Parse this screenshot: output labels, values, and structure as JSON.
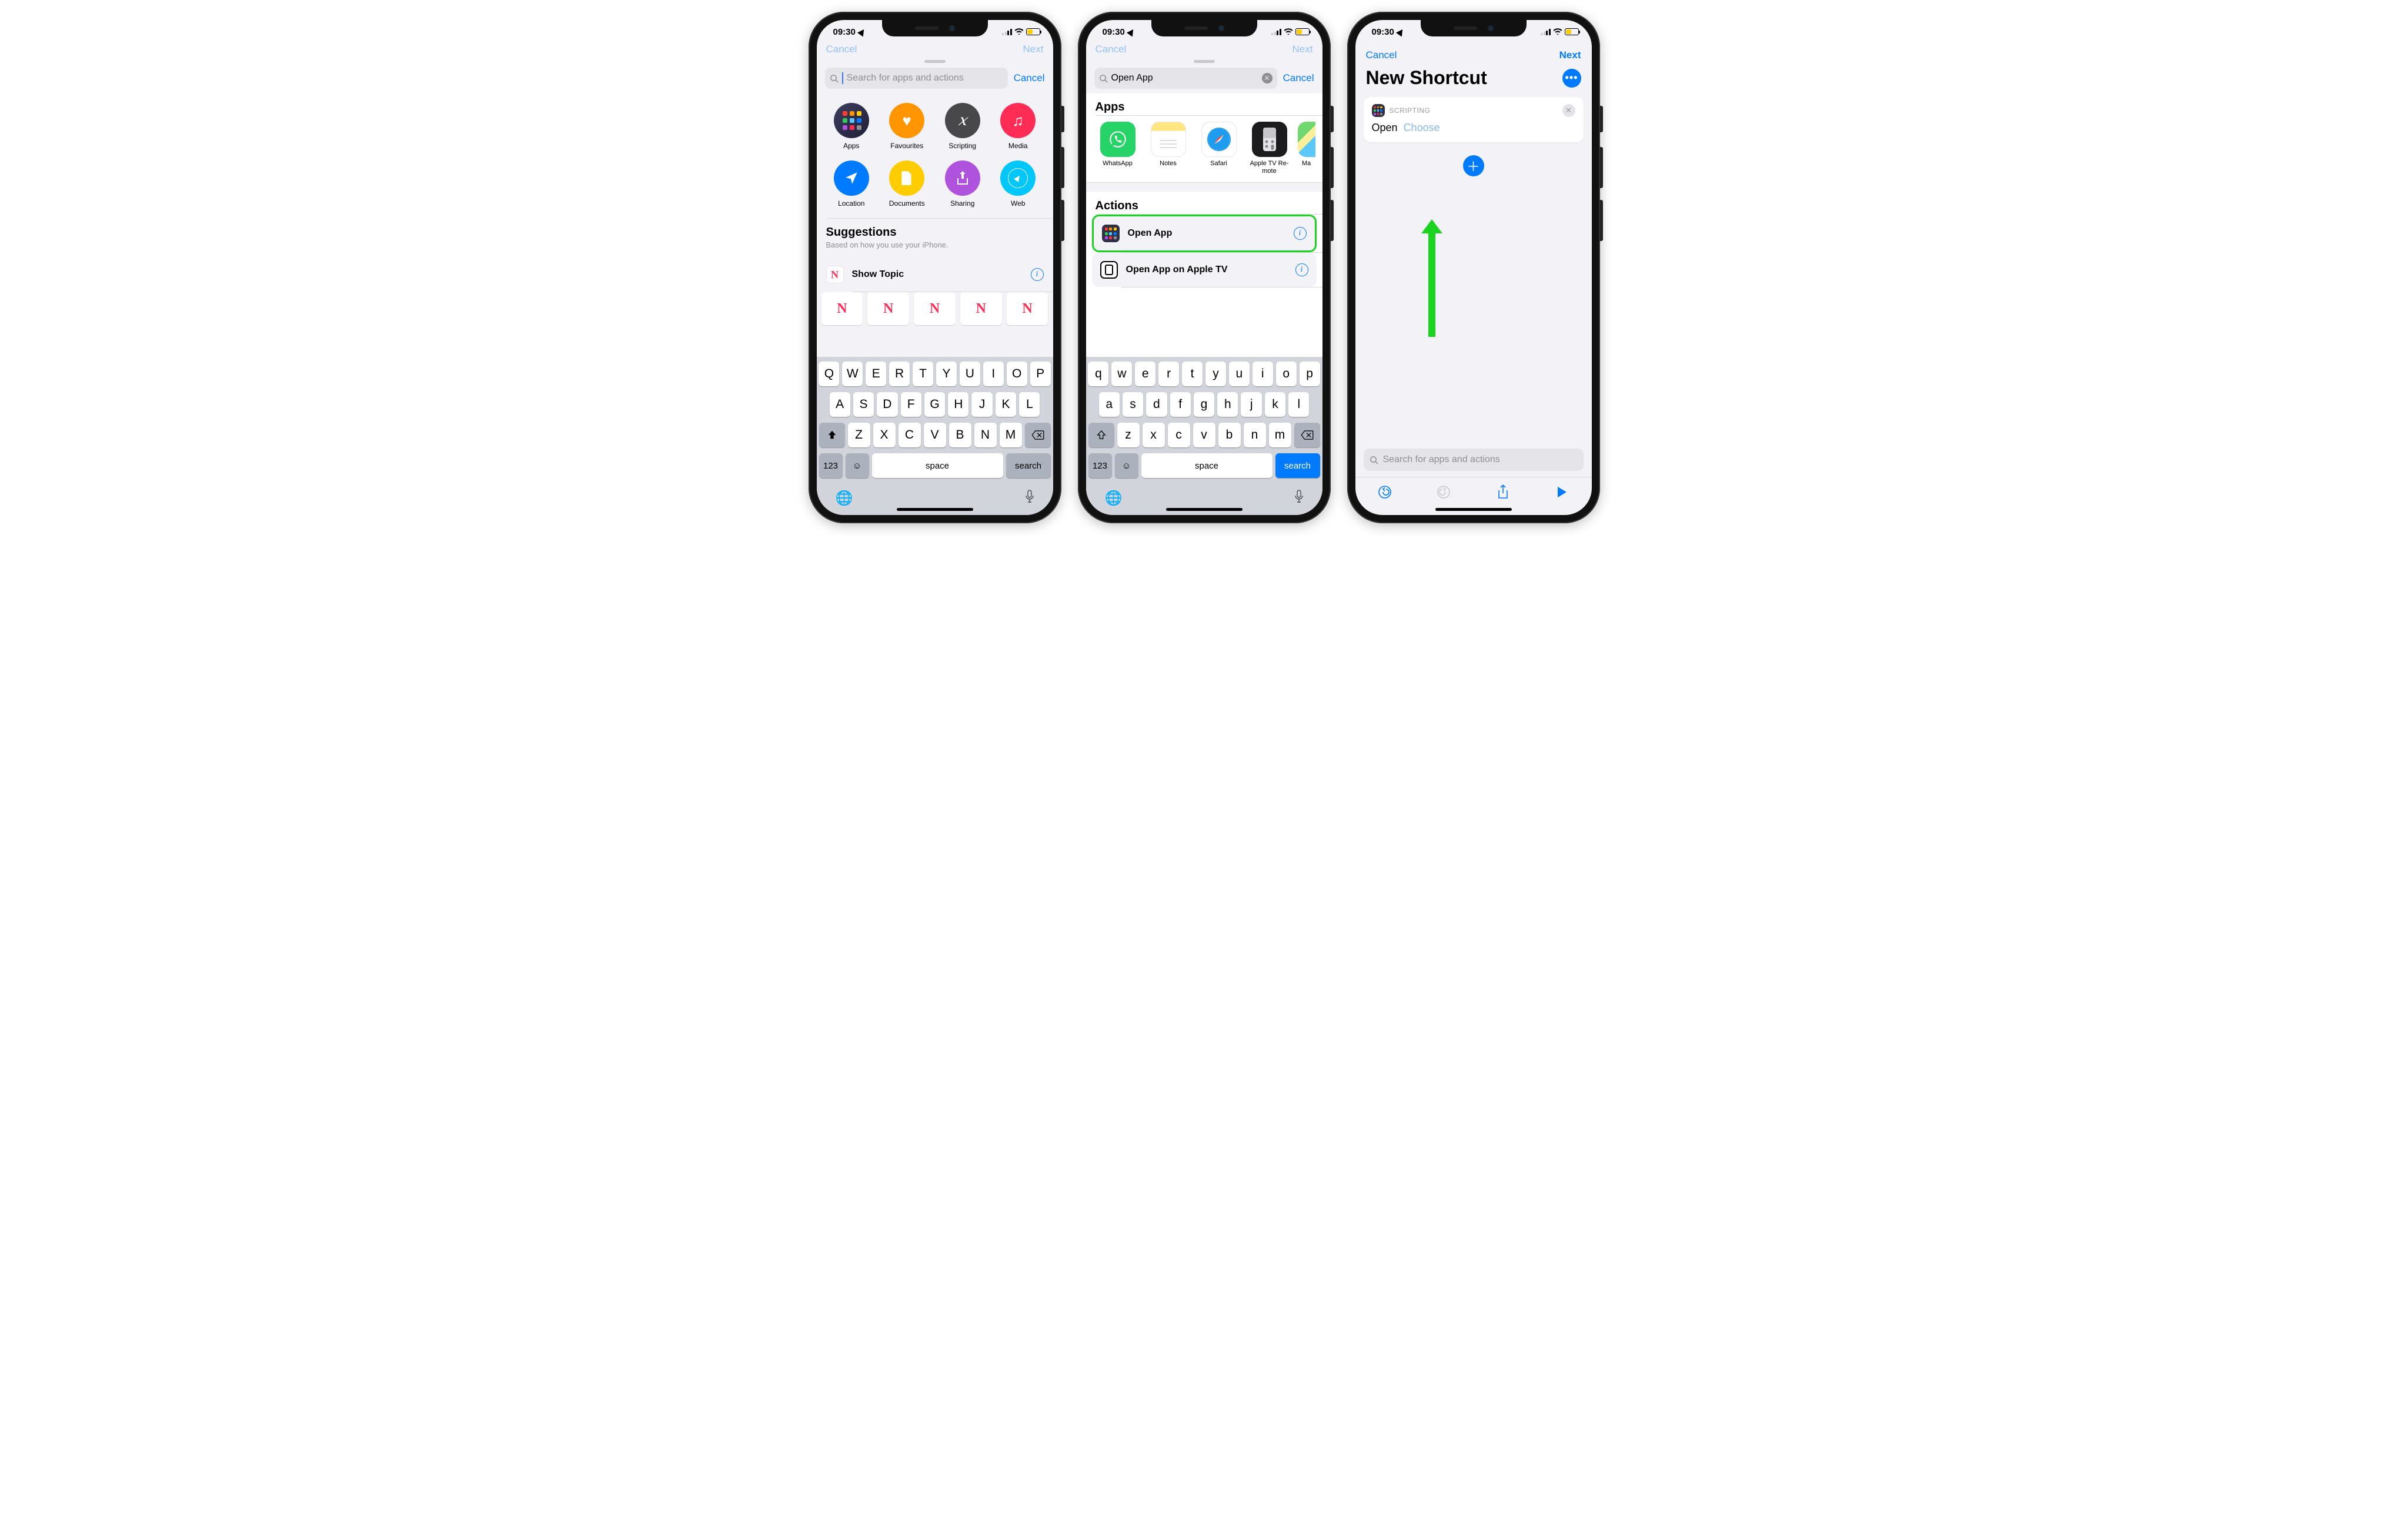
{
  "status": {
    "time": "09:30"
  },
  "screen1": {
    "peek_left": "Cancel",
    "peek_right": "Next",
    "search_placeholder": "Search for apps and actions",
    "cancel": "Cancel",
    "categories": [
      "Apps",
      "Favourites",
      "Scripting",
      "Media",
      "Location",
      "Documents",
      "Sharing",
      "Web"
    ],
    "suggestions_title": "Suggestions",
    "suggestions_sub": "Based on how you use your iPhone.",
    "suggestion_row": "Show Topic",
    "keys_r1": [
      "Q",
      "W",
      "E",
      "R",
      "T",
      "Y",
      "U",
      "I",
      "O",
      "P"
    ],
    "keys_r2": [
      "A",
      "S",
      "D",
      "F",
      "G",
      "H",
      "J",
      "K",
      "L"
    ],
    "keys_r3": [
      "Z",
      "X",
      "C",
      "V",
      "B",
      "N",
      "M"
    ],
    "key_123": "123",
    "key_space": "space",
    "key_search": "search"
  },
  "screen2": {
    "search_value": "Open App",
    "cancel": "Cancel",
    "apps_header": "Apps",
    "apps": [
      "WhatsApp",
      "Notes",
      "Safari",
      "Apple TV Re-\nmote",
      "Ma"
    ],
    "actions_header": "Actions",
    "action1": "Open App",
    "action2": "Open App on Apple TV",
    "keys_r1": [
      "q",
      "w",
      "e",
      "r",
      "t",
      "y",
      "u",
      "i",
      "o",
      "p"
    ],
    "keys_r2": [
      "a",
      "s",
      "d",
      "f",
      "g",
      "h",
      "j",
      "k",
      "l"
    ],
    "keys_r3": [
      "z",
      "x",
      "c",
      "v",
      "b",
      "n",
      "m"
    ],
    "key_123": "123",
    "key_space": "space",
    "key_search": "search"
  },
  "screen3": {
    "cancel": "Cancel",
    "next": "Next",
    "title": "New Shortcut",
    "card_label": "SCRIPTING",
    "open": "Open",
    "choose": "Choose",
    "search_placeholder": "Search for apps and actions"
  }
}
